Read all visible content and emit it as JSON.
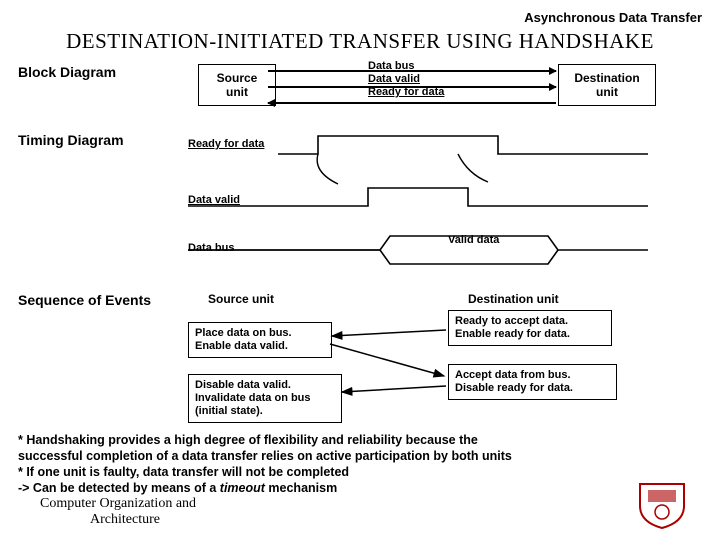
{
  "header": "Asynchronous Data Transfer",
  "title": "DESTINATION-INITIATED  TRANSFER  USING  HANDSHAKE",
  "sections": {
    "block": "Block Diagram",
    "timing": "Timing Diagram",
    "sequence": "Sequence of Events"
  },
  "block": {
    "source": "Source\nunit",
    "destination": "Destination\nunit",
    "signals": {
      "bus": "Data bus",
      "valid": "Data valid",
      "ready": "Ready for data"
    }
  },
  "timing": {
    "ready": "Ready for data",
    "valid": "Data valid",
    "bus": "Data bus",
    "validdata": "Valid data"
  },
  "sequence": {
    "src_header": "Source unit",
    "dst_header": "Destination unit",
    "src_step1": "Place data on bus.\nEnable data valid.",
    "src_step2": "Disable data valid.\nInvalidate data on bus\n(initial state).",
    "dst_step1": "Ready to accept data.\nEnable ready for data.",
    "dst_step2": "Accept data from bus.\nDisable ready for data."
  },
  "notes": {
    "n1": "* Handshaking provides a high degree of flexibility and reliability because the",
    "n2": "     successful completion of a data transfer relies on active participation by both units",
    "n3": "* If one unit is faulty, data transfer will not be completed",
    "n4a": "   -> Can be detected by means of a ",
    "n4b": "timeout",
    "n4c": "  mechanism"
  },
  "footer": {
    "l1": "Computer Organization and",
    "l2": "Architecture"
  }
}
